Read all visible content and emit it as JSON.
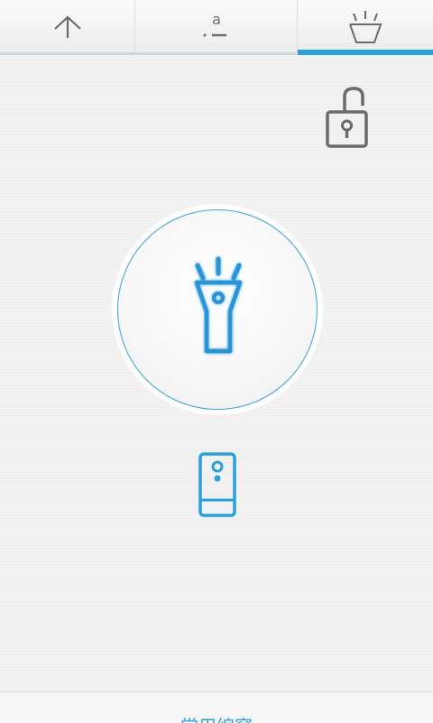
{
  "tabs": [
    {
      "name": "home",
      "icon": "home-icon",
      "active": false
    },
    {
      "name": "text",
      "icon": "text-icon",
      "glyph": "a",
      "active": false
    },
    {
      "name": "flashlight",
      "icon": "flashlight-icon",
      "active": true
    }
  ],
  "lock": {
    "icon": "unlocked-padlock-icon"
  },
  "main_button": {
    "icon": "flashlight-icon",
    "state": "off"
  },
  "screen_light": {
    "icon": "phone-screen-light-icon"
  },
  "bottom_bar": {
    "label": "常用编窗"
  },
  "colors": {
    "accent": "#2b9fd9",
    "icon_gray": "#6b6b6b",
    "background": "#f3f3f3"
  }
}
